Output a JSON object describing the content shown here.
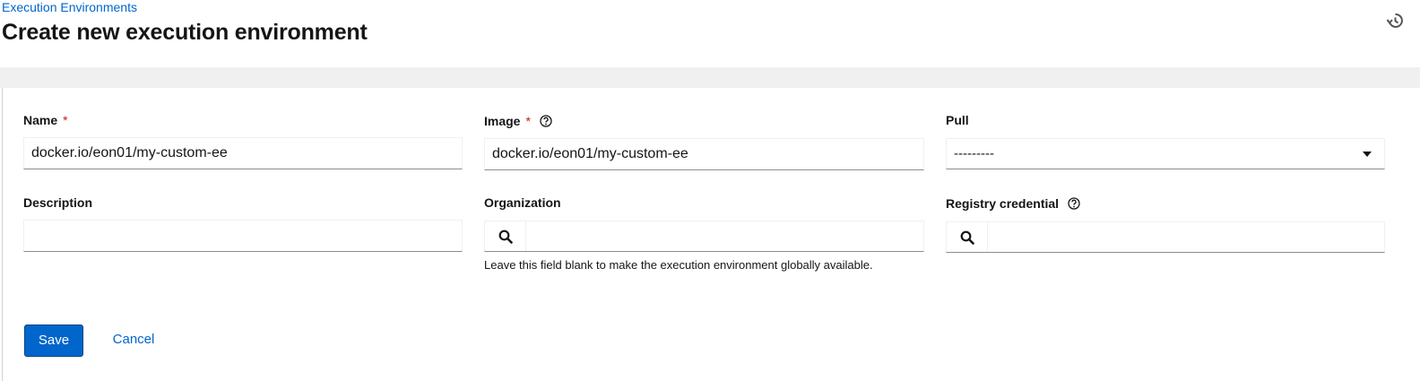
{
  "header": {
    "breadcrumb": "Execution Environments",
    "title": "Create new execution environment",
    "history_icon": "history-icon"
  },
  "form": {
    "name": {
      "label": "Name",
      "required_mark": "*",
      "value": "docker.io/eon01/my-custom-ee"
    },
    "image": {
      "label": "Image",
      "required_mark": "*",
      "help_icon": "question-circle-icon",
      "value": "docker.io/eon01/my-custom-ee"
    },
    "pull": {
      "label": "Pull",
      "selected": "---------",
      "icon": "caret-down-icon"
    },
    "description": {
      "label": "Description",
      "value": ""
    },
    "organization": {
      "label": "Organization",
      "search_icon": "search-icon",
      "value": "",
      "helper": "Leave this field blank to make the execution environment globally available."
    },
    "registry_credential": {
      "label": "Registry credential",
      "help_icon": "question-circle-icon",
      "search_icon": "search-icon",
      "value": ""
    }
  },
  "actions": {
    "save_label": "Save",
    "cancel_label": "Cancel"
  },
  "colors": {
    "link": "#0066cc",
    "primary": "#0066cc",
    "required": "#c9190b",
    "band": "#f0f0f0"
  }
}
